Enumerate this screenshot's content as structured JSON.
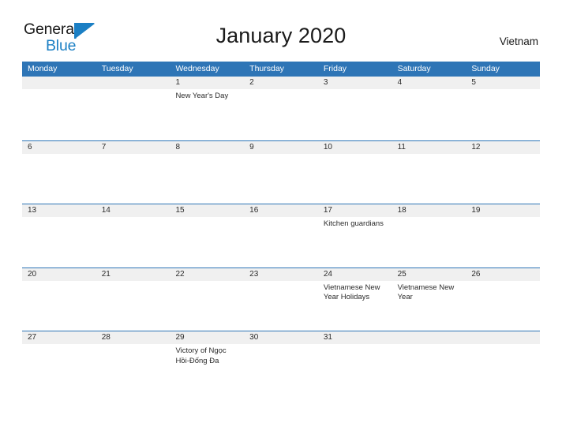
{
  "brand": {
    "name_part1": "General",
    "name_part2": "Blue",
    "flag_icon": "flag-triangle-icon",
    "accent_color": "#1b7fc4"
  },
  "header": {
    "title": "January 2020",
    "country": "Vietnam"
  },
  "colors": {
    "header_blue": "#2E75B6",
    "band_gray": "#f0f0f0",
    "text": "#2b2b2b"
  },
  "calendar": {
    "weekdays": [
      "Monday",
      "Tuesday",
      "Wednesday",
      "Thursday",
      "Friday",
      "Saturday",
      "Sunday"
    ],
    "weeks": [
      [
        {
          "number": "",
          "events": []
        },
        {
          "number": "",
          "events": []
        },
        {
          "number": "1",
          "events": [
            "New Year's Day"
          ]
        },
        {
          "number": "2",
          "events": []
        },
        {
          "number": "3",
          "events": []
        },
        {
          "number": "4",
          "events": []
        },
        {
          "number": "5",
          "events": []
        }
      ],
      [
        {
          "number": "6",
          "events": []
        },
        {
          "number": "7",
          "events": []
        },
        {
          "number": "8",
          "events": []
        },
        {
          "number": "9",
          "events": []
        },
        {
          "number": "10",
          "events": []
        },
        {
          "number": "11",
          "events": []
        },
        {
          "number": "12",
          "events": []
        }
      ],
      [
        {
          "number": "13",
          "events": []
        },
        {
          "number": "14",
          "events": []
        },
        {
          "number": "15",
          "events": []
        },
        {
          "number": "16",
          "events": []
        },
        {
          "number": "17",
          "events": [
            "Kitchen guardians"
          ]
        },
        {
          "number": "18",
          "events": []
        },
        {
          "number": "19",
          "events": []
        }
      ],
      [
        {
          "number": "20",
          "events": []
        },
        {
          "number": "21",
          "events": []
        },
        {
          "number": "22",
          "events": []
        },
        {
          "number": "23",
          "events": []
        },
        {
          "number": "24",
          "events": [
            "Vietnamese New Year Holidays"
          ]
        },
        {
          "number": "25",
          "events": [
            "Vietnamese New Year"
          ]
        },
        {
          "number": "26",
          "events": []
        }
      ],
      [
        {
          "number": "27",
          "events": []
        },
        {
          "number": "28",
          "events": []
        },
        {
          "number": "29",
          "events": [
            "Victory of Ngọc Hồi-Đống Đa"
          ]
        },
        {
          "number": "30",
          "events": []
        },
        {
          "number": "31",
          "events": []
        },
        {
          "number": "",
          "events": []
        },
        {
          "number": "",
          "events": []
        }
      ]
    ]
  }
}
